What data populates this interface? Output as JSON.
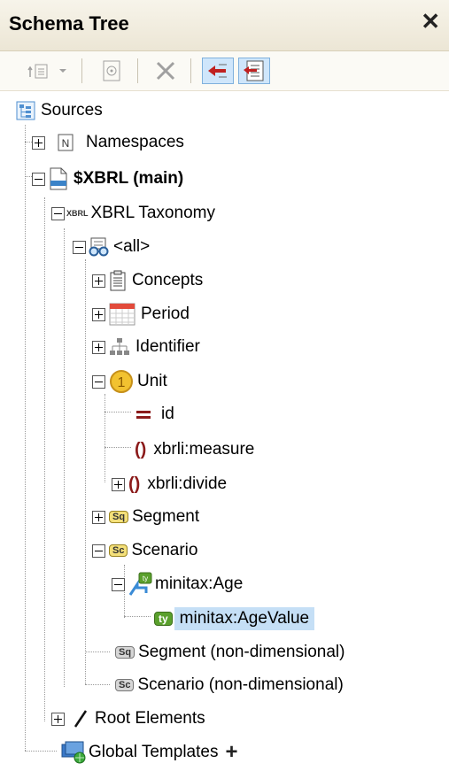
{
  "panel": {
    "title": "Schema Tree"
  },
  "colors": {
    "header_bg": "#ece6d5",
    "selection": "#c5dff6",
    "toolbar_active": "#cfe6fb",
    "element_brace": "#8b1a1a"
  },
  "toolbar": {
    "buttons": [
      "add-child-icon",
      "dropdown-arrow-icon",
      "sources-settings-icon",
      "delete-icon",
      "collapse-back-icon",
      "expand-tree-icon"
    ]
  },
  "tree": {
    "sources": "Sources",
    "namespaces": "Namespaces",
    "main": "$XBRL (main)",
    "xbrl_badge": "XBRL",
    "taxonomy": "XBRL Taxonomy",
    "all": "<all>",
    "concepts": "Concepts",
    "period": "Period",
    "identifier": "Identifier",
    "unit": "Unit",
    "unit_badge": "1",
    "id": "id",
    "measure": "xbrli:measure",
    "divide": "xbrli:divide",
    "segment": "Segment",
    "segment_badge": "Sq",
    "scenario": "Scenario",
    "scenario_badge": "Sc",
    "age": "minitax:Age",
    "type_badge": "ty",
    "age_value": "minitax:AgeValue",
    "segment_nd": "Segment (non-dimensional)",
    "scenario_nd": "Scenario (non-dimensional)",
    "root": "Root Elements",
    "global": "Global Templates"
  }
}
